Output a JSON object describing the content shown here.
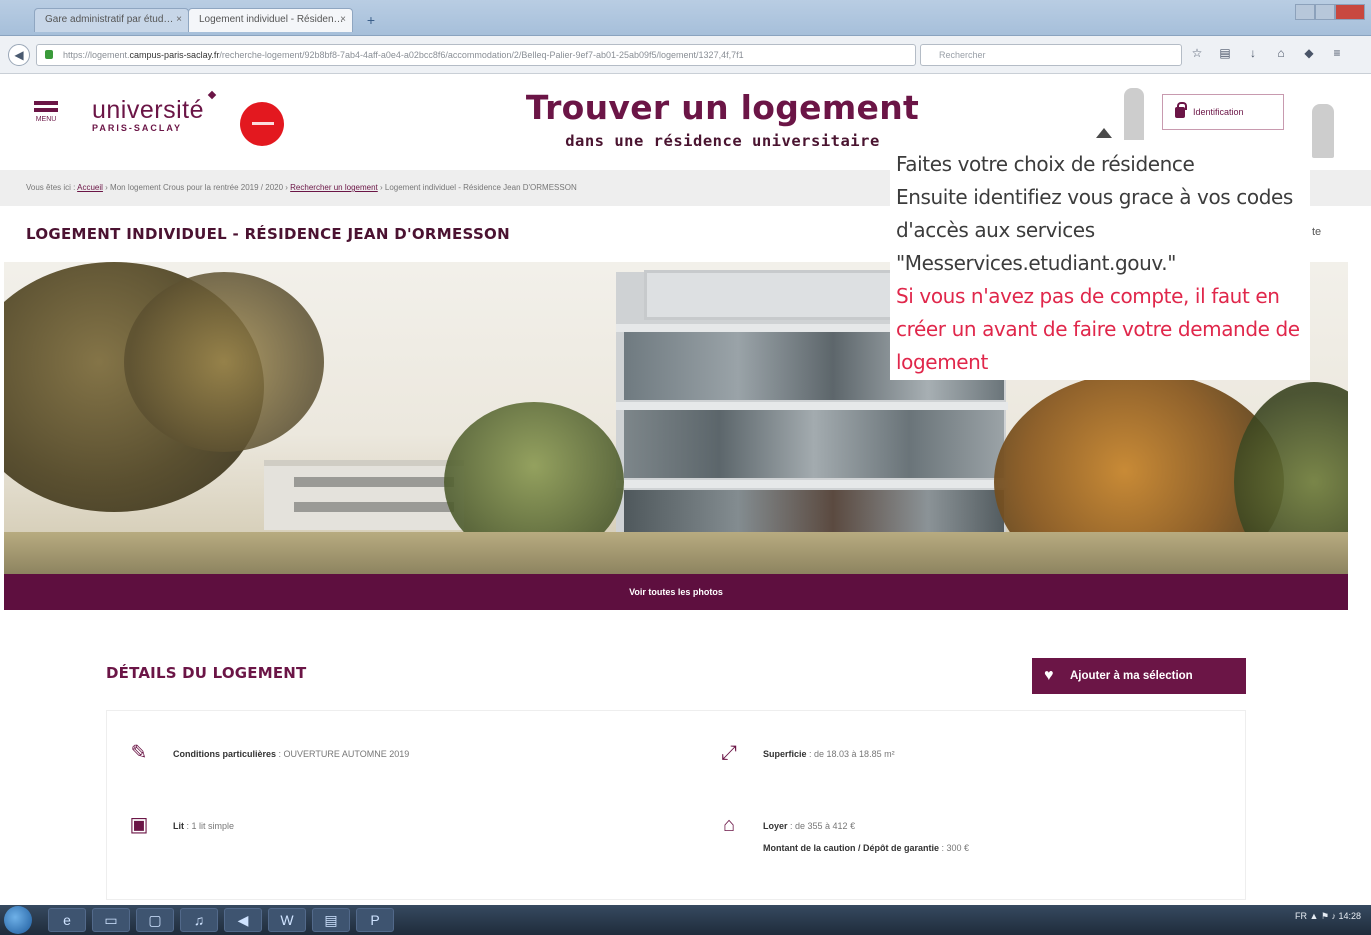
{
  "browser": {
    "tabs": [
      {
        "label": "Gare administratif par étud…"
      },
      {
        "label": "Logement individuel - Résiden…"
      }
    ],
    "new_tab_label": "+",
    "url_prefix": "https://logement.",
    "url_host": "campus-paris-saclay.fr",
    "url_rest": "/recherche-logement/92b8bf8-7ab4-4aff-a0e4-a02bcc8f6/accommodation/2/Belleq-Palier-9ef7-ab01-25ab09f5/logement/1327,4f,7f1",
    "search_placeholder": "Rechercher",
    "icons": [
      "star-icon",
      "library-icon",
      "download-icon",
      "home-icon",
      "shield-icon",
      "menu-icon"
    ]
  },
  "header": {
    "menu_label": "MENU",
    "logo_line1": "université",
    "logo_line2": "PARIS-SACLAY",
    "title": "Trouver un logement",
    "subtitle": "dans une résidence universitaire",
    "identification_label": "Identification"
  },
  "breadcrumb": {
    "prefix": "Vous êtes ici :",
    "home": "Accueil",
    "middle": " › Mon logement Crous pour la rentrée 2019 / 2020 › ",
    "search": "Rechercher un logement",
    "current": " › Logement individuel - Résidence Jean D'ORMESSON"
  },
  "page_title": "LOGEMENT INDIVIDUEL - RÉSIDENCE JEAN D'ORMESSON",
  "side_cut_text": "te",
  "photo_footer_label": "Voir toutes les photos",
  "tooltip": {
    "line1": "Faites votre choix de résidence",
    "line2": "Ensuite identifiez vous grace à vos codes",
    "line3": "d'accès aux services",
    "line4": "\"Messervices.etudiant.gouv.\"",
    "warn1": "Si vous n'avez pas de compte, il faut en",
    "warn2": "créer un avant de faire votre demande de",
    "warn3": "logement"
  },
  "details": {
    "title": "DÉTAILS DU LOGEMENT",
    "add_button": "Ajouter à ma sélection",
    "conditions_label": "Conditions particulières",
    "conditions_value": " : OUVERTURE AUTOMNE 2019",
    "superficie_label": "Superficie",
    "superficie_value": " : de 18.03 à 18.85 m²",
    "lit_label": "Lit",
    "lit_value": " : 1 lit simple",
    "loyer_label": "Loyer",
    "loyer_value": " : de 355 à 412 €",
    "caution_label": "Montant de la caution / Dépôt de garantie",
    "caution_value": " : 300 €"
  },
  "taskbar": {
    "apps": [
      "e",
      "▭",
      "▢",
      "♫",
      "◀",
      "W",
      "▤",
      "P"
    ],
    "tray_text": "FR  ▲  ⚑  ♪  14:28"
  },
  "colors": {
    "brand": "#6b1546",
    "warning_text": "#e0274b",
    "crous_red": "#e3181f",
    "footer_bar": "#5e0f3f"
  }
}
